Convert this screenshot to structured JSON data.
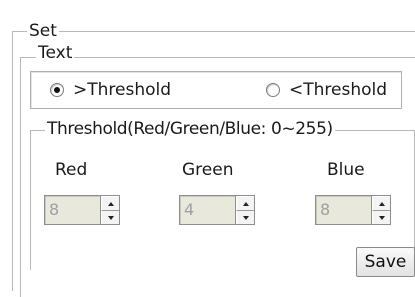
{
  "set_group": {
    "legend": "Set"
  },
  "text_group": {
    "legend": "Text"
  },
  "mode": {
    "options": [
      {
        "label": ">Threshold",
        "checked": true
      },
      {
        "label": "<Threshold",
        "checked": false
      }
    ]
  },
  "threshold_group": {
    "legend": "Threshold(Red/Green/Blue:  0~255)",
    "channels": [
      {
        "label": "Red",
        "value": "8"
      },
      {
        "label": "Green",
        "value": "4"
      },
      {
        "label": "Blue",
        "value": "8"
      }
    ]
  },
  "save_button": {
    "label": "Save"
  }
}
